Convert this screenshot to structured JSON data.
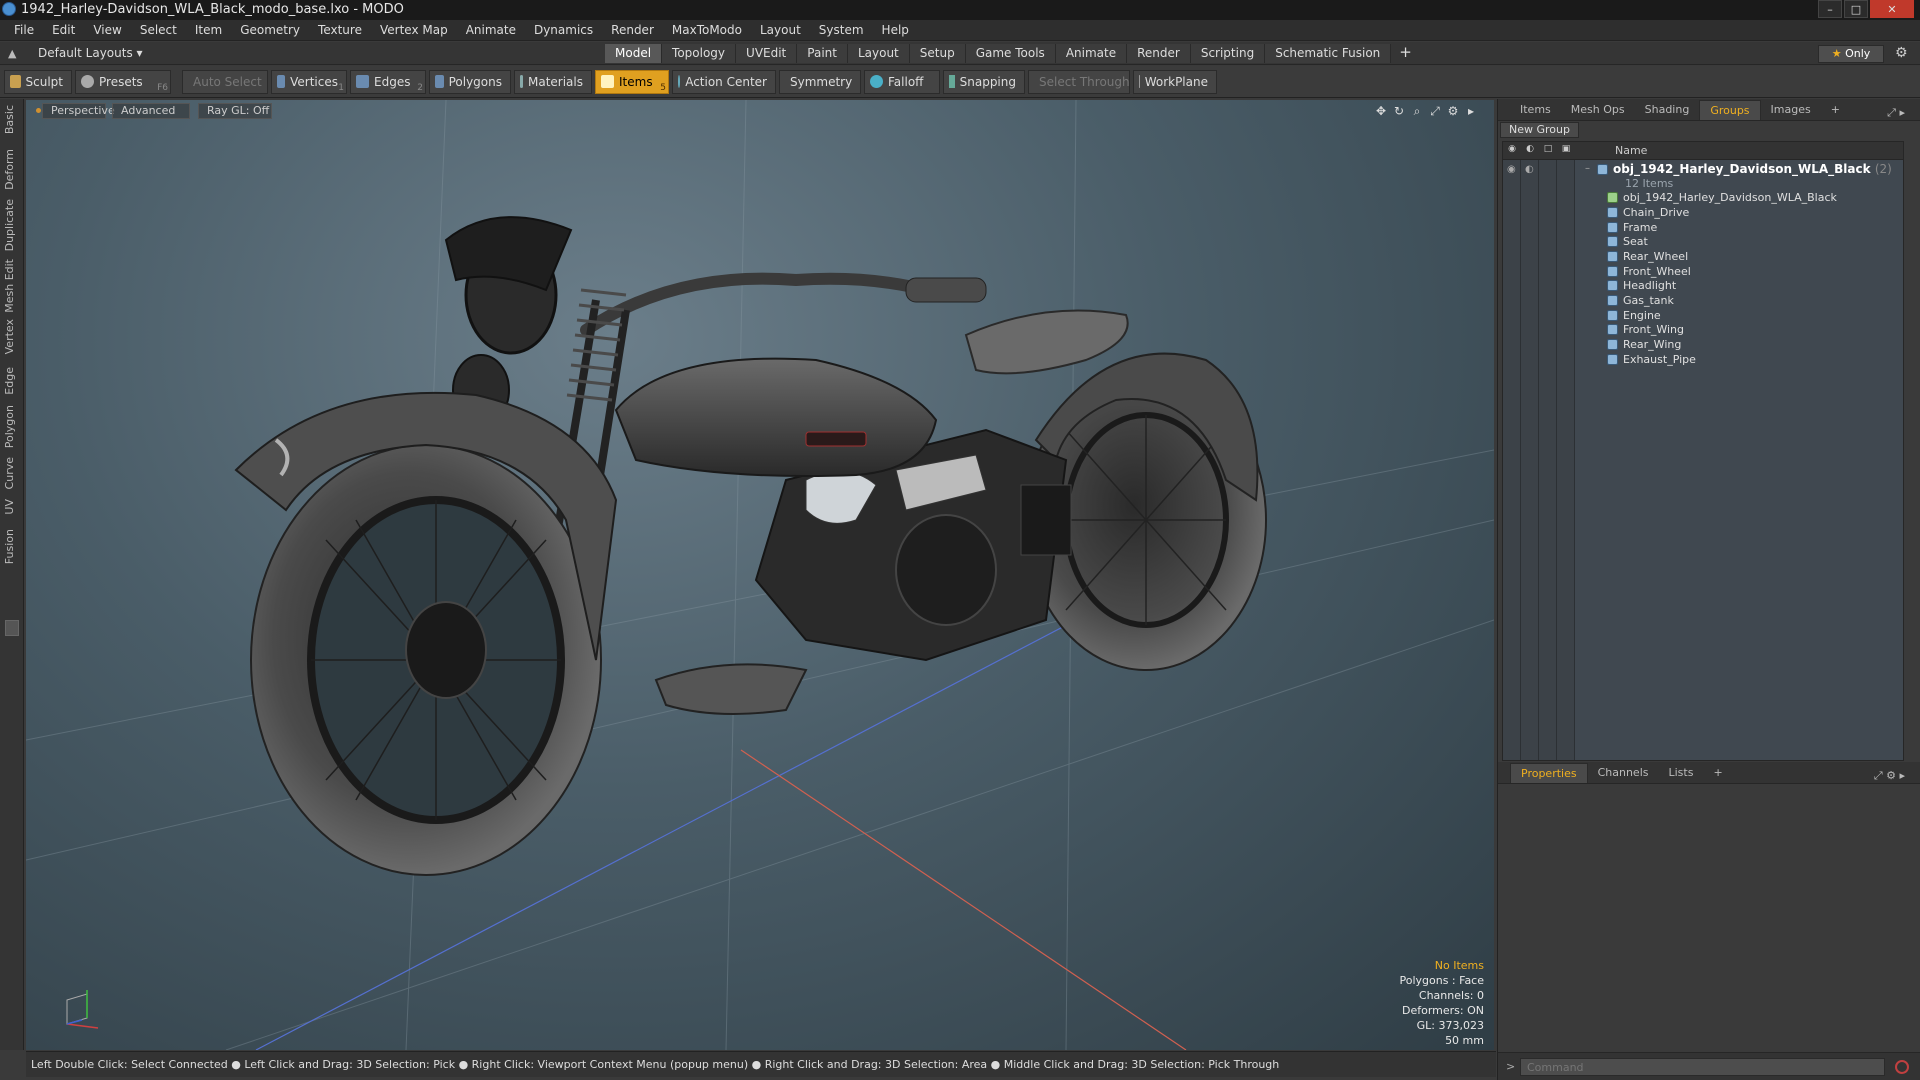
{
  "window": {
    "title": "1942_Harley-Davidson_WLA_Black_modo_base.lxo - MODO",
    "buttons": [
      "–",
      "□",
      "✕"
    ]
  },
  "menu": [
    "File",
    "Edit",
    "View",
    "Select",
    "Item",
    "Geometry",
    "Texture",
    "Vertex Map",
    "Animate",
    "Dynamics",
    "Render",
    "MaxToModo",
    "Layout",
    "System",
    "Help"
  ],
  "layoutbar": {
    "layouts_label": "Default Layouts ▾",
    "tabs": [
      "Model",
      "Topology",
      "UVEdit",
      "Paint",
      "Layout",
      "Setup",
      "Game Tools",
      "Animate",
      "Render",
      "Scripting",
      "Schematic Fusion"
    ],
    "active_tab": "Model",
    "plus": "+",
    "only_label": "Only",
    "only_star": "★"
  },
  "toolbar": {
    "sculpt": "Sculpt",
    "presets": "Presets",
    "presets_key": "F6",
    "auto_select": "Auto Select",
    "vertices": "Vertices",
    "vertices_key": "1",
    "edges": "Edges",
    "edges_key": "2",
    "polygons": "Polygons",
    "materials": "Materials",
    "items": "Items",
    "items_key": "5",
    "action_center": "Action Center",
    "symmetry": "Symmetry",
    "falloff": "Falloff",
    "snapping": "Snapping",
    "select_through": "Select Through",
    "workplane": "WorkPlane"
  },
  "left_tabs": [
    "Basic",
    "Deform",
    "Duplicate",
    "Mesh Edit",
    "Vertex",
    "Edge",
    "Polygon",
    "Curve",
    "UV",
    "Fusion"
  ],
  "viewport": {
    "view": "Perspective",
    "shading": "Advanced",
    "raygl": "Ray GL: Off",
    "info": {
      "no_items": "No Items",
      "polygons": "Polygons : Face",
      "channels": "Channels: 0",
      "deformers": "Deformers: ON",
      "gl": "GL: 373,023",
      "lens": "50 mm"
    }
  },
  "statusbar": "Left Double Click: Select Connected ● Left Click and Drag: 3D Selection: Pick ● Right Click: Viewport Context Menu (popup menu) ● Right Click and Drag: 3D Selection: Area ● Middle Click and Drag: 3D Selection: Pick Through",
  "right_panel": {
    "top_tabs": [
      "Items",
      "Mesh Ops",
      "Shading",
      "Groups",
      "Images"
    ],
    "active_top_tab": "Groups",
    "new_group": "New Group",
    "column_name": "Name",
    "group": {
      "name": "obj_1942_Harley_Davidson_WLA_Black",
      "count": "(2)",
      "items_count": "12 Items",
      "children": [
        "obj_1942_Harley_Davidson_WLA_Black",
        "Chain_Drive",
        "Frame",
        "Seat",
        "Rear_Wheel",
        "Front_Wheel",
        "Headlight",
        "Gas_tank",
        "Engine",
        "Front_Wing",
        "Rear_Wing",
        "Exhaust_Pipe"
      ]
    },
    "bottom_tabs": [
      "Properties",
      "Channels",
      "Lists"
    ],
    "active_bottom_tab": "Properties",
    "command_placeholder": "Command"
  }
}
